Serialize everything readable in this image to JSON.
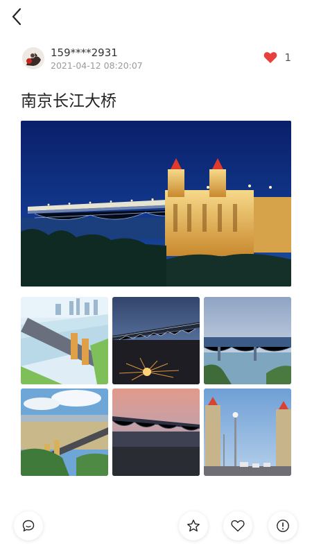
{
  "post": {
    "username": "159****2931",
    "timestamp": "2021-04-12 08:20:07",
    "like_count": "1",
    "title": "南京长江大桥"
  },
  "colors": {
    "accent_red": "#e8403c",
    "night_sky": "#0d2a7a",
    "bridge_light": "#f3c35a"
  },
  "icons": {
    "back": "chevron-left-icon",
    "like": "heart-filled-icon",
    "comment": "comment-icon",
    "favorite": "star-icon",
    "heart_outline": "heart-outline-icon",
    "report": "exclamation-circle-icon"
  }
}
